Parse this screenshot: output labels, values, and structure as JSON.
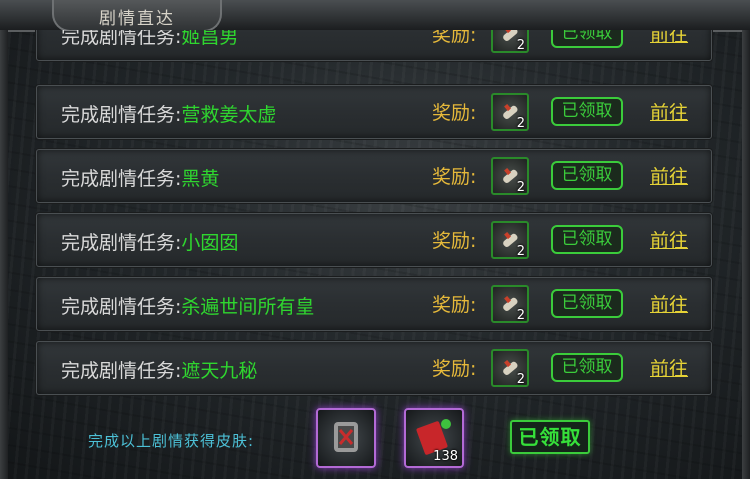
{
  "window": {
    "title": "剧情直达"
  },
  "rows": [
    {
      "task_prefix": "完成剧情任务:",
      "task_name": "姬昌男",
      "reward_label": "奖励:",
      "reward_icon": "scroll-icon",
      "reward_count": "2",
      "status": "已领取",
      "goto": "前往"
    },
    {
      "task_prefix": "完成剧情任务:",
      "task_name": "营救姜太虚",
      "reward_label": "奖励:",
      "reward_icon": "scroll-icon",
      "reward_count": "2",
      "status": "已领取",
      "goto": "前往"
    },
    {
      "task_prefix": "完成剧情任务:",
      "task_name": "黑黄",
      "reward_label": "奖励:",
      "reward_icon": "scroll-icon",
      "reward_count": "2",
      "status": "已领取",
      "goto": "前往"
    },
    {
      "task_prefix": "完成剧情任务:",
      "task_name": "小囡囡",
      "reward_label": "奖励:",
      "reward_icon": "scroll-icon",
      "reward_count": "2",
      "status": "已领取",
      "goto": "前往"
    },
    {
      "task_prefix": "完成剧情任务:",
      "task_name": "杀遍世间所有皇",
      "reward_label": "奖励:",
      "reward_icon": "scroll-icon",
      "reward_count": "2",
      "status": "已领取",
      "goto": "前往"
    },
    {
      "task_prefix": "完成剧情任务:",
      "task_name": "遮天九秘",
      "reward_label": "奖励:",
      "reward_icon": "scroll-icon",
      "reward_count": "2",
      "status": "已领取",
      "goto": "前往"
    }
  ],
  "footer": {
    "label": "完成以上剧情获得皮肤:",
    "skin1_icon": "armor-skin-icon",
    "skin2_icon": "red-packet-icon",
    "skin2_count": "138",
    "claimed": "已领取"
  },
  "colors": {
    "task_name": "#2fd62f",
    "reward_label": "#e6b93a",
    "goto": "#e6d336",
    "claimed": "#3bcc3b",
    "footer_label": "#4cc0d6"
  }
}
